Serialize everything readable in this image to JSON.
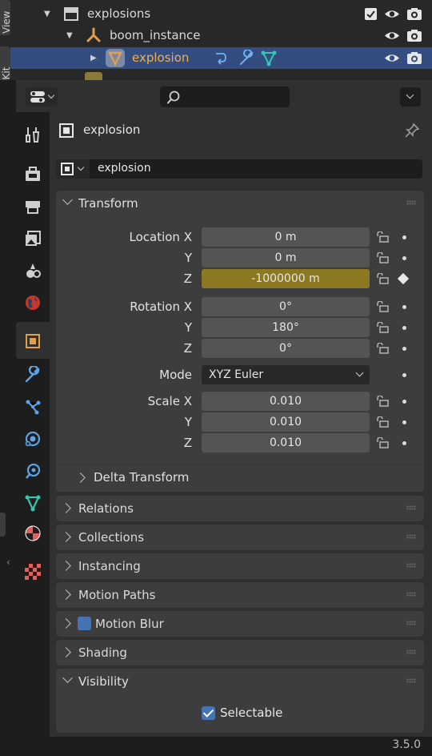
{
  "outliner": {
    "side_tab_top": "View",
    "side_tab_bottom": "BlenderKit",
    "rows": [
      {
        "label": "explosions"
      },
      {
        "label": "boom_instance"
      },
      {
        "label": "explosion"
      }
    ]
  },
  "properties": {
    "search_placeholder": "",
    "object_name_header": "explosion",
    "object_name_field": "explosion",
    "transform": {
      "title": "Transform",
      "location_label": "Location X",
      "loc_x": "0 m",
      "loc_y": "0 m",
      "loc_z": "-1000000 m",
      "rotation_label": "Rotation X",
      "rot_x": "0°",
      "rot_y": "180°",
      "rot_z": "0°",
      "mode_label": "Mode",
      "mode_value": "XYZ Euler",
      "scale_label": "Scale X",
      "scale_x": "0.010",
      "scale_y": "0.010",
      "scale_z": "0.010",
      "y_label": "Y",
      "z_label": "Z",
      "delta_transform": "Delta Transform"
    },
    "panels": {
      "relations": "Relations",
      "collections": "Collections",
      "instancing": "Instancing",
      "motion_paths": "Motion Paths",
      "motion_blur": "Motion Blur",
      "shading": "Shading",
      "visibility": "Visibility"
    },
    "selectable_label": "Selectable"
  },
  "status": {
    "version": "3.5.0"
  },
  "colors": {
    "accent": "#4772b3",
    "animated_field": "#8c7a22",
    "object_orange": "#e0a04a",
    "modifier_blue": "#5fa3e6",
    "data_teal": "#33c9b0"
  }
}
